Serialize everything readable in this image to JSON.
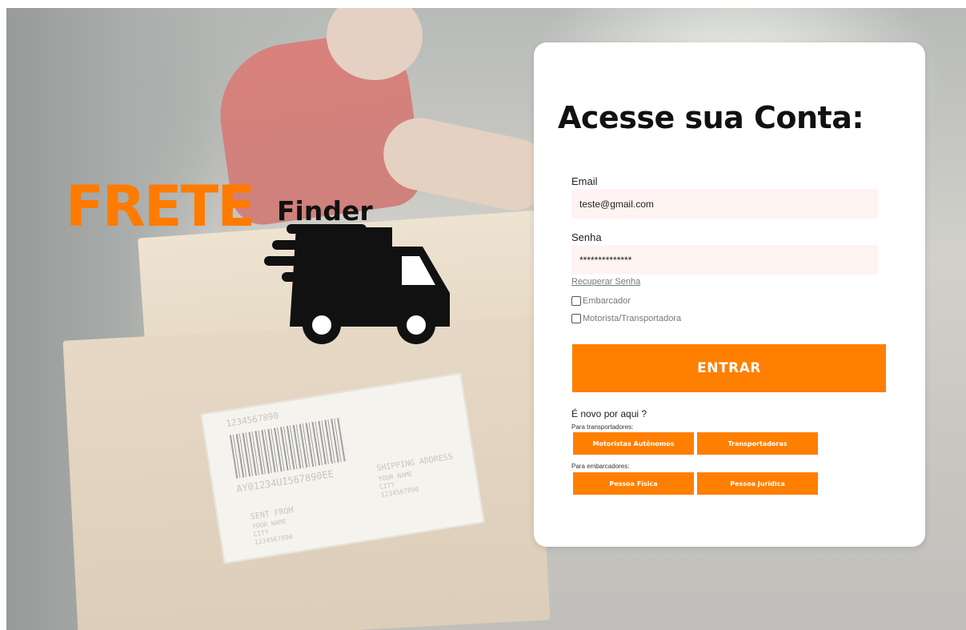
{
  "brand": {
    "name_primary": "FRETE",
    "name_secondary": "Finder",
    "accent_color": "#ff7f00"
  },
  "background": {
    "barcode_number": "1234567890",
    "tracking_code": "AY01234UI567890EE",
    "sent_from": "SENT FROM",
    "your_name": "YOUR NAME",
    "city": "CITY",
    "zip": "1234567890",
    "shipping_address": "SHIPPING ADDRESS"
  },
  "login": {
    "title": "Acesse sua Conta:",
    "email_label": "Email",
    "email_value": "teste@gmail.com",
    "password_label": "Senha",
    "password_value": "**************",
    "recover_link": "Recuperar Senha",
    "options": [
      {
        "label": "Embarcador",
        "checked": false
      },
      {
        "label": "Motorista/Transportadora",
        "checked": false
      }
    ],
    "submit_label": "ENTRAR"
  },
  "signup": {
    "heading": "É novo por aqui ?",
    "carriers_label": "Para transportadores:",
    "carriers_buttons": [
      "Motoristas Autônomos",
      "Transportadoras"
    ],
    "shippers_label": "Para embarcadores:",
    "shippers_buttons": [
      "Pessoa Física",
      "Pessoa Jurídica"
    ]
  }
}
